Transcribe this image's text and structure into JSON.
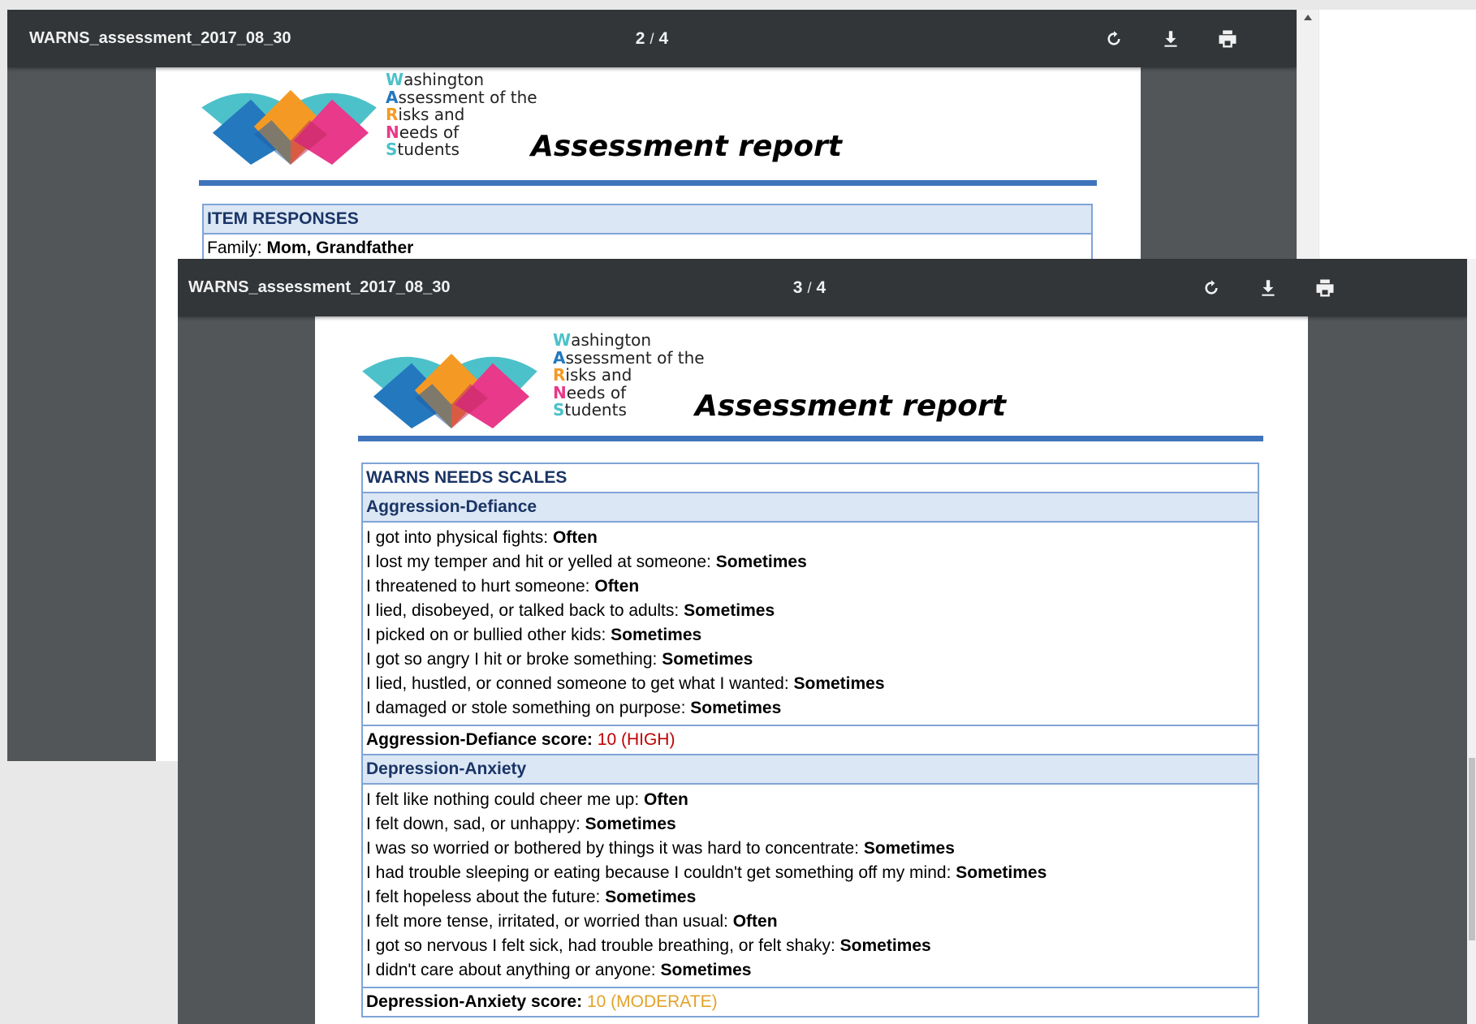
{
  "colors": {
    "toolbar": "#323639",
    "viewer_bg": "#525659",
    "accent_rule": "#3f74bc",
    "high": "#c00000",
    "moderate": "#e2a22a"
  },
  "back_viewer": {
    "title": "WARNS_assessment_2017_08_30",
    "current_page": "2",
    "total_pages": "4",
    "page": {
      "logo_letters": [
        "W",
        "A",
        "R",
        "N",
        "S"
      ],
      "logo_rests": [
        "ashington",
        "ssessment of the",
        "isks and",
        "eeds of",
        "tudents"
      ],
      "report_title": "Assessment report",
      "section_title": "ITEM RESPONSES",
      "family_label": "Family: ",
      "family_value": "Mom, Grandfather"
    }
  },
  "front_viewer": {
    "title": "WARNS_assessment_2017_08_30",
    "current_page": "3",
    "total_pages": "4",
    "page": {
      "logo_letters": [
        "W",
        "A",
        "R",
        "N",
        "S"
      ],
      "logo_rests": [
        "ashington",
        "ssessment of the",
        "isks and",
        "eeds of",
        "tudents"
      ],
      "report_title": "Assessment report",
      "section_title": "WARNS NEEDS SCALES",
      "scales": [
        {
          "name": "Aggression-Defiance",
          "items": [
            {
              "q": "I got into physical fights: ",
              "a": "Often"
            },
            {
              "q": "I lost my temper and hit or yelled at someone: ",
              "a": "Sometimes"
            },
            {
              "q": "I threatened to hurt someone: ",
              "a": "Often"
            },
            {
              "q": "I lied, disobeyed, or talked back to adults: ",
              "a": "Sometimes"
            },
            {
              "q": "I picked on or bullied other kids: ",
              "a": "Sometimes"
            },
            {
              "q": "I got so angry I hit or broke something: ",
              "a": "Sometimes"
            },
            {
              "q": "I lied, hustled, or conned someone to get what I wanted: ",
              "a": "Sometimes"
            },
            {
              "q": "I damaged or stole something on purpose: ",
              "a": "Sometimes"
            }
          ],
          "score_label": "Aggression-Defiance score: ",
          "score_value": "10 (HIGH)"
        },
        {
          "name": "Depression-Anxiety",
          "items": [
            {
              "q": "I felt like nothing could cheer me up: ",
              "a": "Often"
            },
            {
              "q": "I felt down, sad, or unhappy: ",
              "a": "Sometimes"
            },
            {
              "q": "I was so worried or bothered by things it was hard to concentrate: ",
              "a": "Sometimes"
            },
            {
              "q": "I had trouble sleeping or eating because I couldn't get something off my mind: ",
              "a": "Sometimes"
            },
            {
              "q": "I felt hopeless about the future: ",
              "a": "Sometimes"
            },
            {
              "q": "I felt more tense, irritated, or worried than usual: ",
              "a": "Often"
            },
            {
              "q": "I got so nervous I felt sick, had trouble breathing, or felt shaky: ",
              "a": "Sometimes"
            },
            {
              "q": "I didn't care about anything or anyone: ",
              "a": "Sometimes"
            }
          ],
          "score_label": "Depression-Anxiety score: ",
          "score_value": "10 (MODERATE)"
        }
      ]
    }
  },
  "icons": [
    "rotate-icon",
    "download-icon",
    "print-icon"
  ]
}
